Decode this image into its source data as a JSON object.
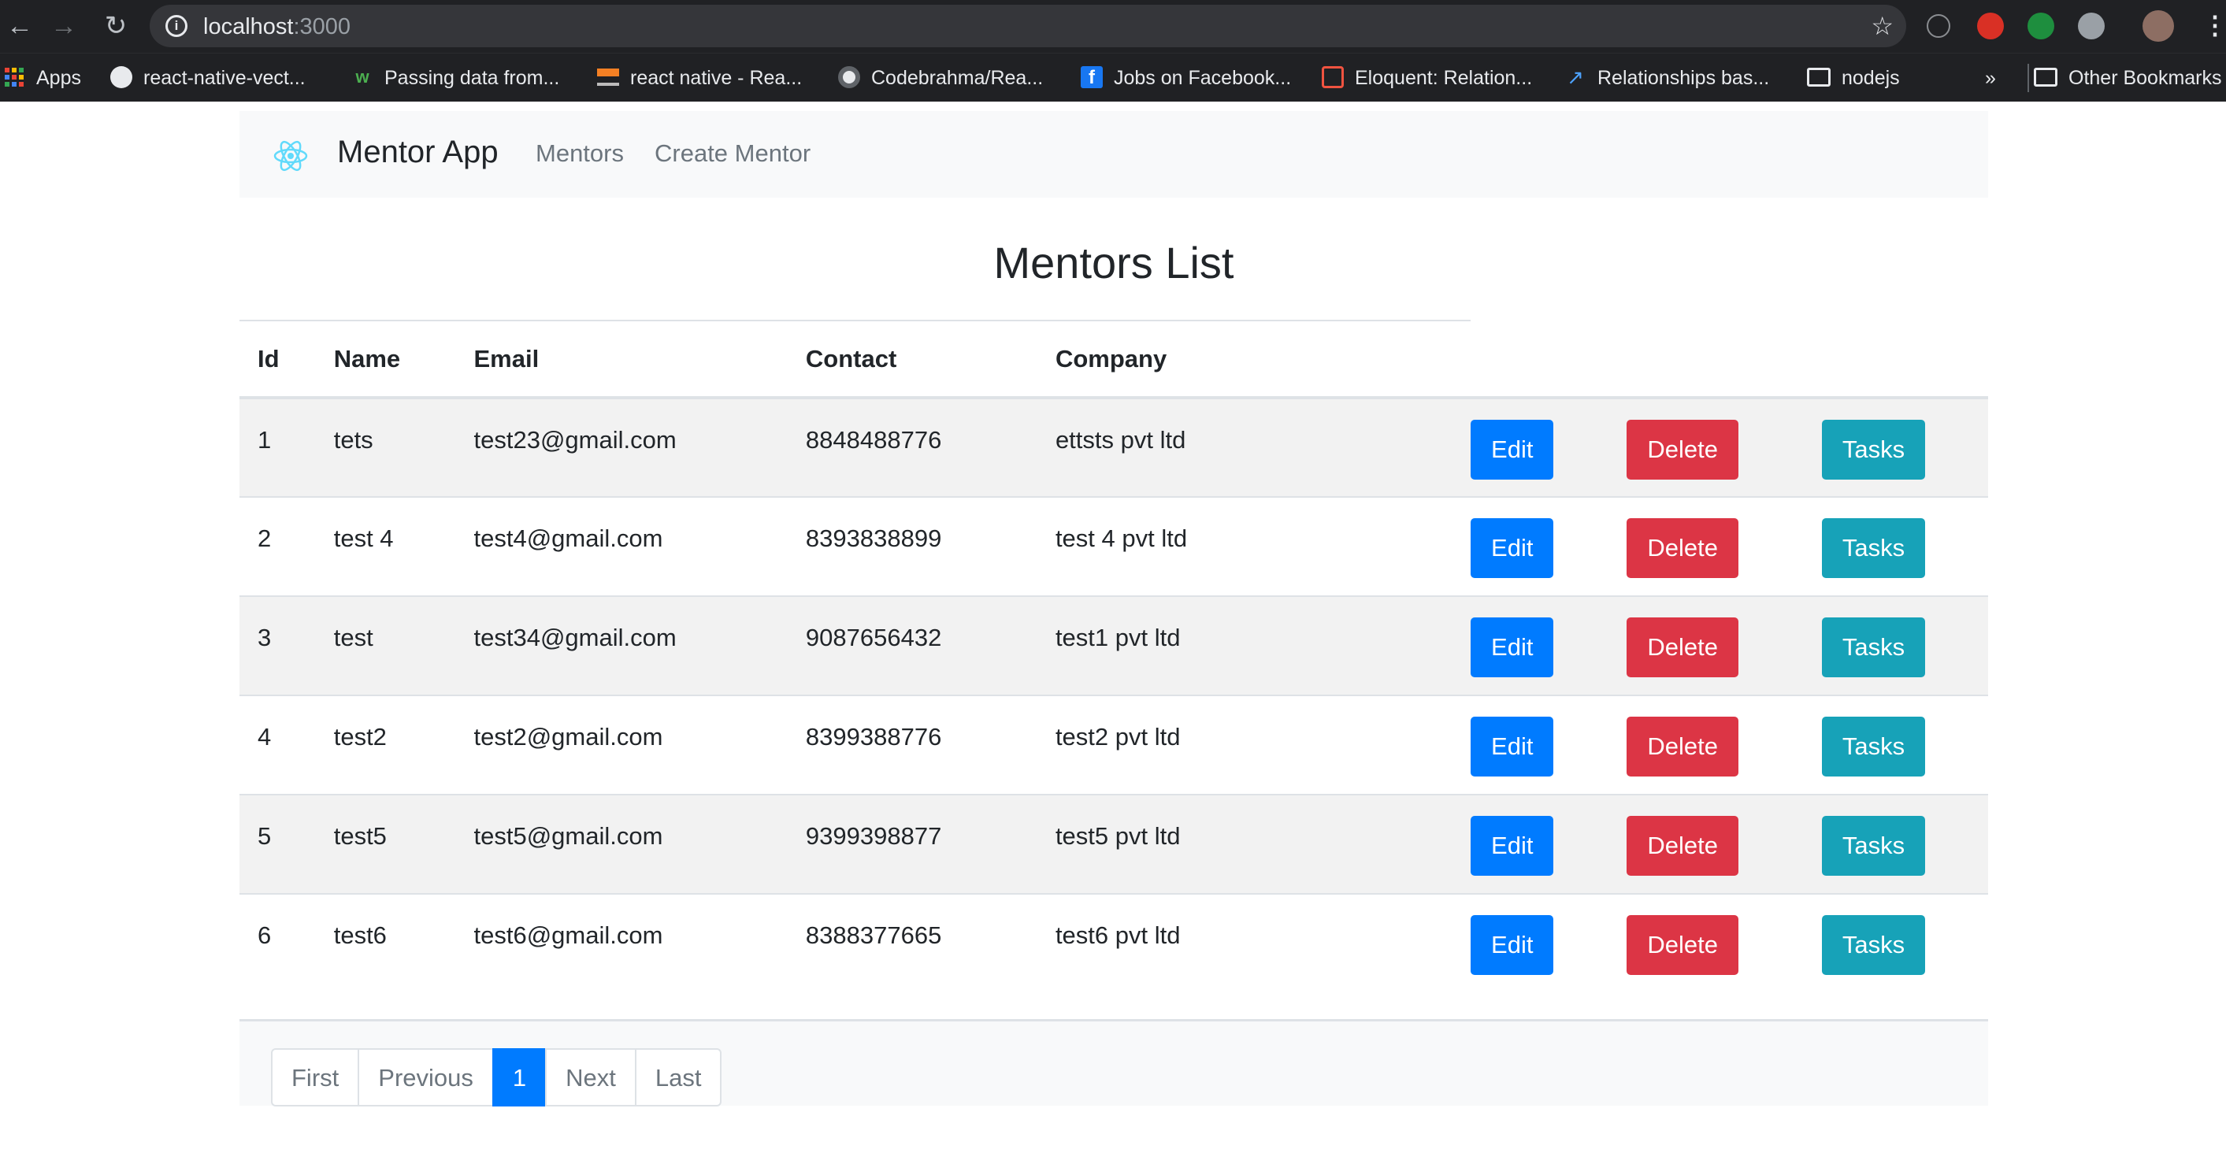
{
  "browser": {
    "url_host": "localhost",
    "url_port": ":3000",
    "bookmarks": [
      {
        "label": "Apps",
        "icon": "apps-grid-icon"
      },
      {
        "label": "react-native-vect...",
        "icon": "globe-icon"
      },
      {
        "label": "Passing data from...",
        "icon": "w3schools-icon"
      },
      {
        "label": "react native - Rea...",
        "icon": "stackoverflow-icon"
      },
      {
        "label": "Codebrahma/Rea...",
        "icon": "github-icon"
      },
      {
        "label": "Jobs on Facebook...",
        "icon": "facebook-icon"
      },
      {
        "label": "Eloquent: Relation...",
        "icon": "laravel-icon"
      },
      {
        "label": "Relationships bas...",
        "icon": "bookmark-icon"
      },
      {
        "label": "nodejs",
        "icon": "folder-icon"
      }
    ],
    "overflow": "»",
    "other_bookmarks": "Other Bookmarks"
  },
  "navbar": {
    "brand": "Mentor App",
    "links": [
      "Mentors",
      "Create Mentor"
    ]
  },
  "page": {
    "title": "Mentors List"
  },
  "table": {
    "headers": [
      "Id",
      "Name",
      "Email",
      "Contact",
      "Company"
    ],
    "actions": {
      "edit": "Edit",
      "delete": "Delete",
      "tasks": "Tasks"
    },
    "rows": [
      {
        "id": "1",
        "name": "tets",
        "email": "test23@gmail.com",
        "contact": "8848488776",
        "company": "ettsts pvt ltd"
      },
      {
        "id": "2",
        "name": "test 4",
        "email": "test4@gmail.com",
        "contact": "8393838899",
        "company": "test 4 pvt ltd"
      },
      {
        "id": "3",
        "name": "test",
        "email": "test34@gmail.com",
        "contact": "9087656432",
        "company": "test1 pvt ltd"
      },
      {
        "id": "4",
        "name": "test2",
        "email": "test2@gmail.com",
        "contact": "8399388776",
        "company": "test2 pvt ltd"
      },
      {
        "id": "5",
        "name": "test5",
        "email": "test5@gmail.com",
        "contact": "9399398877",
        "company": "test5 pvt ltd"
      },
      {
        "id": "6",
        "name": "test6",
        "email": "test6@gmail.com",
        "contact": "8388377665",
        "company": "test6 pvt ltd"
      }
    ]
  },
  "pagination": {
    "first": "First",
    "previous": "Previous",
    "current": "1",
    "next": "Next",
    "last": "Last"
  },
  "colors": {
    "primary": "#007bff",
    "danger": "#dc3545",
    "info": "#17a2b8",
    "navbar_bg": "#f8f9fa",
    "chrome_bg": "#202124"
  }
}
